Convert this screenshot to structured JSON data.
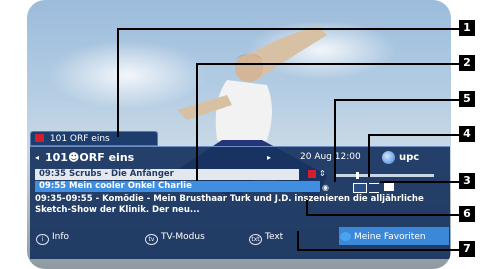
{
  "channel_tab": {
    "label": "101 ORF eins"
  },
  "osd": {
    "header": {
      "arrow_left": "◂",
      "channel": "101☻ORF eins",
      "arrow_right": "▸",
      "datetime": "20 Aug 12:00",
      "provider": "upc"
    },
    "program_rows": [
      {
        "text": "09:35  Scrubs - Die Anfänger"
      },
      {
        "text": "09:55  Mein cooler Onkel Charlie"
      }
    ],
    "description": "09:35-09:55 - Komödie - Mein Brusthaar Turk und J.D. inszenieren die alljährliche Sketch-Show der Klinik. Der neu...",
    "footer": {
      "info": "Info",
      "tv_mode": "TV-Modus",
      "text": "Text",
      "favorites": "Meine Favoriten"
    }
  },
  "callouts": [
    "1",
    "2",
    "5",
    "4",
    "3",
    "6",
    "7"
  ],
  "colors": {
    "panel": "#1c3d6e",
    "highlight": "#3f8ee0",
    "favorites": "#3b88d9",
    "badge": "#d21e2d"
  },
  "icons": [
    "orf-badge-icon",
    "channel-logo-icon",
    "up-down-arrows-icon",
    "eye-icon",
    "picture-format-icon",
    "subtitle-icon",
    "info-key-icon",
    "tv-key-icon",
    "text-key-icon",
    "blue-key-icon"
  ]
}
